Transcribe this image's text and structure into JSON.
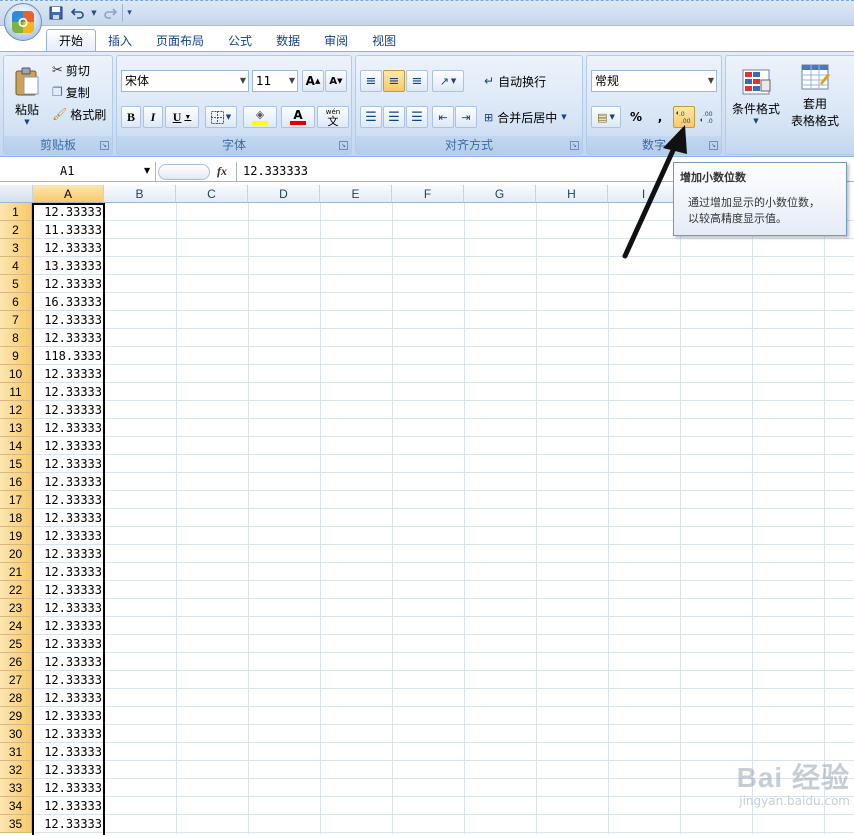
{
  "qat": {
    "save_icon": "save-icon",
    "undo_icon": "undo-icon",
    "redo_icon": "redo-icon",
    "customize_icon": "customize-icon"
  },
  "office_button": {
    "logo_letter": "O"
  },
  "tabs": [
    "开始",
    "插入",
    "页面布局",
    "公式",
    "数据",
    "审阅",
    "视图"
  ],
  "active_tab": 0,
  "ribbon": {
    "clipboard": {
      "label": "剪贴板",
      "paste": "粘贴",
      "cut": "剪切",
      "copy": "复制",
      "format_painter": "格式刷"
    },
    "font": {
      "label": "字体",
      "font_name": "宋体",
      "font_size": "11",
      "bold": "B",
      "italic": "I",
      "underline": "U",
      "grow": "A",
      "shrink": "A",
      "font_color_letter": "A",
      "wen": "wén",
      "wen_char": "文"
    },
    "alignment": {
      "label": "对齐方式",
      "wrap_text": "自动换行",
      "merge_center": "合并后居中"
    },
    "number": {
      "label": "数字",
      "format": "常规",
      "percent": "%",
      "comma": ",",
      "inc_decimal": "+.0\n.00",
      "dec_decimal": ".00\n→.0"
    },
    "styles": {
      "conditional_format": "条件格式",
      "table_format_1": "套用",
      "table_format_2": "表格格式"
    }
  },
  "tooltip": {
    "title": "增加小数位数",
    "body_line1": "通过增加显示的小数位数，",
    "body_line2": "以较高精度显示值。"
  },
  "formula_bar": {
    "name_box": "A1",
    "fx": "fx",
    "value": "12.333333"
  },
  "columns": [
    "A",
    "B",
    "C",
    "D",
    "E",
    "F",
    "G",
    "H",
    "I"
  ],
  "rows": [
    {
      "n": "1",
      "a": "12.33333"
    },
    {
      "n": "2",
      "a": "11.33333"
    },
    {
      "n": "3",
      "a": "12.33333"
    },
    {
      "n": "4",
      "a": "13.33333"
    },
    {
      "n": "5",
      "a": "12.33333"
    },
    {
      "n": "6",
      "a": "16.33333"
    },
    {
      "n": "7",
      "a": "12.33333"
    },
    {
      "n": "8",
      "a": "12.33333"
    },
    {
      "n": "9",
      "a": "118.3333"
    },
    {
      "n": "10",
      "a": "12.33333"
    },
    {
      "n": "11",
      "a": "12.33333"
    },
    {
      "n": "12",
      "a": "12.33333"
    },
    {
      "n": "13",
      "a": "12.33333"
    },
    {
      "n": "14",
      "a": "12.33333"
    },
    {
      "n": "15",
      "a": "12.33333"
    },
    {
      "n": "16",
      "a": "12.33333"
    },
    {
      "n": "17",
      "a": "12.33333"
    },
    {
      "n": "18",
      "a": "12.33333"
    },
    {
      "n": "19",
      "a": "12.33333"
    },
    {
      "n": "20",
      "a": "12.33333"
    },
    {
      "n": "21",
      "a": "12.33333"
    },
    {
      "n": "22",
      "a": "12.33333"
    },
    {
      "n": "23",
      "a": "12.33333"
    },
    {
      "n": "24",
      "a": "12.33333"
    },
    {
      "n": "25",
      "a": "12.33333"
    },
    {
      "n": "26",
      "a": "12.33333"
    },
    {
      "n": "27",
      "a": "12.33333"
    },
    {
      "n": "28",
      "a": "12.33333"
    },
    {
      "n": "29",
      "a": "12.33333"
    },
    {
      "n": "30",
      "a": "12.33333"
    },
    {
      "n": "31",
      "a": "12.33333"
    },
    {
      "n": "32",
      "a": "12.33333"
    },
    {
      "n": "33",
      "a": "12.33333"
    },
    {
      "n": "34",
      "a": "12.33333"
    },
    {
      "n": "35",
      "a": "12.33333"
    }
  ],
  "watermark": {
    "main": "Bai 经验",
    "sub": "jingyan.baidu.com"
  },
  "colors": {
    "accent": "#15428b",
    "selected_header": "#f8c96a",
    "ribbon": "#d0e0f4"
  }
}
